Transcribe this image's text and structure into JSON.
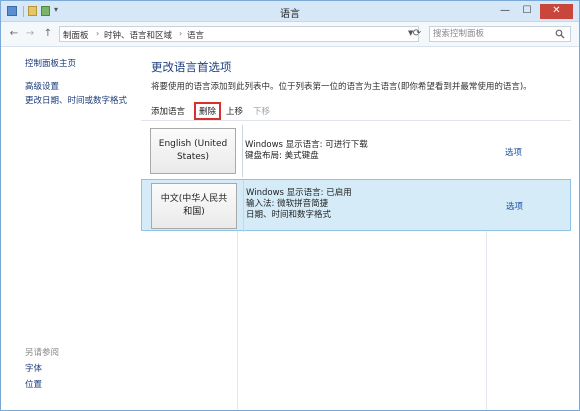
{
  "window": {
    "title": "语言"
  },
  "address": {
    "crumbs": [
      "制面板",
      "时钟、语言和区域",
      "语言"
    ],
    "search_placeholder": "搜索控制面板"
  },
  "leftnav": {
    "home": "控制面板主页",
    "advanced": "高级设置",
    "datetime": "更改日期、时间或数字格式",
    "see_also": "另请参阅",
    "fonts": "字体",
    "location": "位置"
  },
  "main": {
    "heading": "更改语言首选项",
    "description": "将要使用的语言添加到此列表中。位于列表第一位的语言为主语言(即你希望看到并最常使用的语言)。"
  },
  "toolbar": {
    "add": "添加语言",
    "remove": "删除",
    "move_up": "上移",
    "move_down": "下移"
  },
  "languages": [
    {
      "name_line1": "English (United",
      "name_line2": "States)",
      "info": [
        "Windows 显示语言: 可进行下载",
        "键盘布局: 美式键盘"
      ],
      "options": "选项"
    },
    {
      "name_line1": "中文(中华人民共",
      "name_line2": "和国)",
      "info": [
        "Windows 显示语言: 已启用",
        "输入法: 微软拼音简捷",
        "日期、时间和数字格式"
      ],
      "options": "选项"
    }
  ],
  "colors": {
    "accent": "#1f3f7f",
    "selected_row": "#d5ebf7",
    "highlight_border": "#d8302b",
    "close": "#c9463d"
  },
  "icons": [
    "app-icon",
    "search-icon",
    "back-arrow-icon",
    "forward-arrow-icon",
    "up-arrow-icon",
    "refresh-icon",
    "minimize-icon",
    "maximize-icon",
    "close-icon"
  ]
}
